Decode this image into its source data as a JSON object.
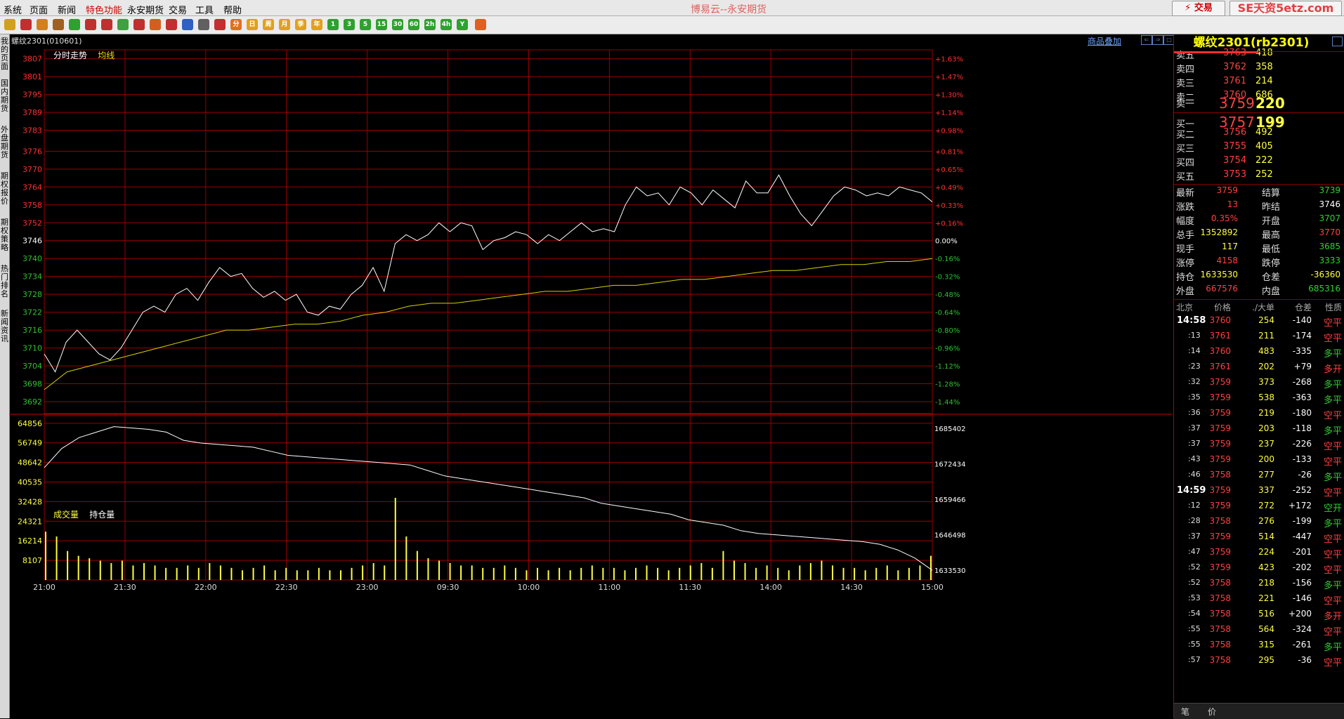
{
  "app": {
    "title": "博易云--永安期货",
    "trade_button": "⚡ 交易",
    "watermark": "SE天资5etz.com"
  },
  "menu": [
    "系统",
    "页面",
    "新闻",
    "特色功能",
    "永安期货",
    "交易",
    "工具",
    "帮助"
  ],
  "toolbar": {
    "icons": [
      "back-icon",
      "home-icon",
      "page-icon",
      "book-icon",
      "refresh-icon",
      "zoom-in-icon",
      "zoom-out-icon",
      "window-icon",
      "pen-icon",
      "paint-icon",
      "filter-icon",
      "news-icon",
      "table-icon",
      "chart-icon"
    ],
    "periods": [
      "分",
      "日",
      "周",
      "月",
      "季",
      "年",
      "1",
      "3",
      "5",
      "15",
      "30",
      "60",
      "2h",
      "4h",
      "Y"
    ]
  },
  "left_tabs": [
    "我的页面",
    "国内期货",
    "外盘期货",
    "期权报价",
    "期权策略",
    "热门排名",
    "新闻资讯"
  ],
  "chart": {
    "symbol_header": "螺纹2301(010601)",
    "overlay_link": "商品叠加",
    "price_legend": {
      "label": "分时走势",
      "avg_label": "均线"
    },
    "vol_legend": {
      "vol_label": "成交量",
      "oi_label": "持仓量"
    },
    "colors": {
      "bg": "#000000",
      "grid": "#9a0000",
      "up": "#ff3030",
      "down": "#30c030",
      "flat": "#ffffff",
      "avg": "#d8d000",
      "vol": "#ffff40",
      "oi": "#ffffff"
    }
  },
  "chart_data": [
    {
      "type": "line",
      "reference_price": 3746,
      "ylim": [
        3688,
        3810
      ],
      "left_ticks": [
        3807,
        3801,
        3795,
        3789,
        3783,
        3776,
        3770,
        3764,
        3758,
        3752,
        3746,
        3740,
        3734,
        3728,
        3722,
        3716,
        3710,
        3704,
        3698,
        3692
      ],
      "right_ticks": [
        "+1.63%",
        "+1.47%",
        "+1.30%",
        "+1.14%",
        "+0.98%",
        "+0.81%",
        "+0.65%",
        "+0.49%",
        "+0.33%",
        "+0.16%",
        "0.00%",
        "-0.16%",
        "-0.32%",
        "-0.48%",
        "-0.64%",
        "-0.80%",
        "-0.96%",
        "-1.12%",
        "-1.28%",
        "-1.44%"
      ],
      "x_ticks": [
        "21:00",
        "21:30",
        "22:00",
        "22:30",
        "23:00",
        "09:30",
        "10:00",
        "11:00",
        "11:30",
        "14:00",
        "14:30",
        "15:00"
      ],
      "series": [
        {
          "name": "分时走势",
          "values": [
            3708,
            3702,
            3712,
            3716,
            3712,
            3708,
            3706,
            3710,
            3716,
            3722,
            3724,
            3722,
            3728,
            3730,
            3726,
            3732,
            3737,
            3734,
            3735,
            3730,
            3727,
            3729,
            3726,
            3728,
            3722,
            3721,
            3724,
            3723,
            3728,
            3731,
            3737,
            3729,
            3745,
            3748,
            3746,
            3748,
            3752,
            3749,
            3752,
            3751,
            3743,
            3746,
            3747,
            3749,
            3748,
            3745,
            3748,
            3746,
            3749,
            3752,
            3749,
            3750,
            3749,
            3758,
            3764,
            3761,
            3762,
            3758,
            3764,
            3762,
            3758,
            3763,
            3760,
            3757,
            3766,
            3762,
            3762,
            3768,
            3761,
            3755,
            3751,
            3756,
            3761,
            3764,
            3763,
            3761,
            3762,
            3761,
            3764,
            3763,
            3762,
            3759
          ]
        },
        {
          "name": "均线",
          "values": [
            3696,
            3702,
            3704,
            3706,
            3708,
            3710,
            3712,
            3714,
            3716,
            3716,
            3717,
            3718,
            3718,
            3719,
            3721,
            3722,
            3724,
            3725,
            3725,
            3726,
            3727,
            3728,
            3729,
            3729,
            3730,
            3731,
            3731,
            3732,
            3733,
            3733,
            3734,
            3735,
            3736,
            3736,
            3737,
            3738,
            3738,
            3739,
            3739,
            3740
          ]
        }
      ]
    },
    {
      "type": "bar",
      "ylim": [
        0,
        68000
      ],
      "left_ticks": [
        64856,
        56749,
        48642,
        40535,
        32428,
        24321,
        16214,
        8107
      ],
      "right_ticks": [
        1685402,
        1672434,
        1659466,
        1646498,
        1633530
      ],
      "oi_ylim": [
        1630000,
        1690000
      ],
      "series": [
        {
          "name": "成交量",
          "values": [
            20000,
            18000,
            12000,
            10000,
            9000,
            8000,
            7000,
            8000,
            6000,
            7000,
            6000,
            5000,
            5000,
            6000,
            5000,
            7000,
            6000,
            5000,
            4000,
            5000,
            6000,
            4000,
            5000,
            4000,
            4000,
            5000,
            4000,
            4000,
            5000,
            6000,
            7000,
            6000,
            34000,
            18000,
            12000,
            9000,
            8000,
            7000,
            6000,
            6000,
            5000,
            5000,
            6000,
            5000,
            4000,
            5000,
            4000,
            5000,
            4000,
            5000,
            6000,
            5000,
            5000,
            4000,
            5000,
            6000,
            5000,
            4000,
            5000,
            6000,
            7000,
            5000,
            12000,
            8000,
            7000,
            5000,
            6000,
            5000,
            4000,
            6000,
            7000,
            8000,
            6000,
            5000,
            5000,
            4000,
            5000,
            6000,
            4000,
            5000,
            6000,
            10000
          ]
        },
        {
          "name": "持仓量",
          "values": [
            1671000,
            1678000,
            1682000,
            1684000,
            1686000,
            1685500,
            1685000,
            1684000,
            1681000,
            1680000,
            1679500,
            1679000,
            1678500,
            1677000,
            1675500,
            1675000,
            1674500,
            1674000,
            1673500,
            1673000,
            1672500,
            1672000,
            1670000,
            1668000,
            1667000,
            1666000,
            1665000,
            1664000,
            1663000,
            1662000,
            1661000,
            1660000,
            1658000,
            1657000,
            1656000,
            1655000,
            1654000,
            1652000,
            1651000,
            1650000,
            1648000,
            1647000,
            1646500,
            1646000,
            1645500,
            1645000,
            1644500,
            1644000,
            1643000,
            1641000,
            1638000,
            1633530
          ]
        }
      ]
    }
  ],
  "quote": {
    "title": "螺纹2301(rb2301)",
    "asks": [
      {
        "label": "卖五",
        "price": "3763",
        "vol": "418"
      },
      {
        "label": "卖四",
        "price": "3762",
        "vol": "358"
      },
      {
        "label": "卖三",
        "price": "3761",
        "vol": "214"
      },
      {
        "label": "卖二",
        "price": "3760",
        "vol": "686"
      },
      {
        "label": "卖一",
        "price": "3759",
        "vol": "220"
      }
    ],
    "bids": [
      {
        "label": "买一",
        "price": "3757",
        "vol": "199"
      },
      {
        "label": "买二",
        "price": "3756",
        "vol": "492"
      },
      {
        "label": "买三",
        "price": "3755",
        "vol": "405"
      },
      {
        "label": "买四",
        "price": "3754",
        "vol": "222"
      },
      {
        "label": "买五",
        "price": "3753",
        "vol": "252"
      }
    ],
    "stats": [
      {
        "l1": "最新",
        "v1": "3759",
        "c1": "#ff4040",
        "l2": "结算",
        "v2": "3739",
        "c2": "#30d030"
      },
      {
        "l1": "涨跌",
        "v1": "13",
        "c1": "#ff4040",
        "l2": "昨结",
        "v2": "3746",
        "c2": "#ffffff"
      },
      {
        "l1": "幅度",
        "v1": "0.35%",
        "c1": "#ff4040",
        "l2": "开盘",
        "v2": "3707",
        "c2": "#30d030"
      },
      {
        "l1": "总手",
        "v1": "1352892",
        "c1": "#ffff40",
        "l2": "最高",
        "v2": "3770",
        "c2": "#ff4040"
      },
      {
        "l1": "现手",
        "v1": "117",
        "c1": "#ffff40",
        "l2": "最低",
        "v2": "3685",
        "c2": "#30d030"
      },
      {
        "l1": "涨停",
        "v1": "4158",
        "c1": "#ff4040",
        "l2": "跌停",
        "v2": "3333",
        "c2": "#30d030"
      },
      {
        "l1": "持仓",
        "v1": "1633530",
        "c1": "#ffff40",
        "l2": "仓差",
        "v2": "-36360",
        "c2": "#ffff40"
      },
      {
        "l1": "外盘",
        "v1": "667576",
        "c1": "#ff4040",
        "l2": "内盘",
        "v2": "685316",
        "c2": "#30d030"
      }
    ],
    "ticks_header": {
      "time": "北京",
      "price": "价格",
      "vol": "./大单",
      "oi": "仓差",
      "nature": "性质"
    },
    "ticks": [
      {
        "time": "14:58",
        "price": "3760",
        "vol": "254",
        "oi": "-140",
        "nature": "空平",
        "nc": "#ff4040"
      },
      {
        "time": ":13",
        "price": "3761",
        "vol": "211",
        "oi": "-174",
        "nature": "空平",
        "nc": "#ff4040"
      },
      {
        "time": ":14",
        "price": "3760",
        "vol": "483",
        "oi": "-335",
        "nature": "多平",
        "nc": "#30d030"
      },
      {
        "time": ":23",
        "price": "3761",
        "vol": "202",
        "oi": "+79",
        "nature": "多开",
        "nc": "#ff4040"
      },
      {
        "time": ":32",
        "price": "3759",
        "vol": "373",
        "oi": "-268",
        "nature": "多平",
        "nc": "#30d030"
      },
      {
        "time": ":35",
        "price": "3759",
        "vol": "538",
        "oi": "-363",
        "nature": "多平",
        "nc": "#30d030"
      },
      {
        "time": ":36",
        "price": "3759",
        "vol": "219",
        "oi": "-180",
        "nature": "空平",
        "nc": "#ff4040"
      },
      {
        "time": ":37",
        "price": "3759",
        "vol": "203",
        "oi": "-118",
        "nature": "多平",
        "nc": "#30d030"
      },
      {
        "time": ":37",
        "price": "3759",
        "vol": "237",
        "oi": "-226",
        "nature": "空平",
        "nc": "#ff4040"
      },
      {
        "time": ":43",
        "price": "3759",
        "vol": "200",
        "oi": "-133",
        "nature": "空平",
        "nc": "#ff4040"
      },
      {
        "time": ":46",
        "price": "3758",
        "vol": "277",
        "oi": "-26",
        "nature": "多平",
        "nc": "#30d030"
      },
      {
        "time": "14:59",
        "price": "3759",
        "vol": "337",
        "oi": "-252",
        "nature": "空平",
        "nc": "#ff4040"
      },
      {
        "time": ":12",
        "price": "3759",
        "vol": "272",
        "oi": "+172",
        "nature": "空开",
        "nc": "#30d030"
      },
      {
        "time": ":28",
        "price": "3758",
        "vol": "276",
        "oi": "-199",
        "nature": "多平",
        "nc": "#30d030"
      },
      {
        "time": ":37",
        "price": "3759",
        "vol": "514",
        "oi": "-447",
        "nature": "空平",
        "nc": "#ff4040"
      },
      {
        "time": ":47",
        "price": "3759",
        "vol": "224",
        "oi": "-201",
        "nature": "空平",
        "nc": "#ff4040"
      },
      {
        "time": ":52",
        "price": "3759",
        "vol": "423",
        "oi": "-202",
        "nature": "空平",
        "nc": "#ff4040"
      },
      {
        "time": ":52",
        "price": "3758",
        "vol": "218",
        "oi": "-156",
        "nature": "多平",
        "nc": "#30d030"
      },
      {
        "time": ":53",
        "price": "3758",
        "vol": "221",
        "oi": "-146",
        "nature": "空平",
        "nc": "#ff4040"
      },
      {
        "time": ":54",
        "price": "3758",
        "vol": "516",
        "oi": "+200",
        "nature": "多开",
        "nc": "#ff4040"
      },
      {
        "time": ":55",
        "price": "3758",
        "vol": "564",
        "oi": "-324",
        "nature": "空平",
        "nc": "#ff4040"
      },
      {
        "time": ":55",
        "price": "3758",
        "vol": "315",
        "oi": "-261",
        "nature": "多平",
        "nc": "#30d030"
      },
      {
        "time": ":57",
        "price": "3758",
        "vol": "295",
        "oi": "-36",
        "nature": "空平",
        "nc": "#ff4040"
      }
    ],
    "footer_tabs": [
      "笔",
      "价"
    ]
  }
}
